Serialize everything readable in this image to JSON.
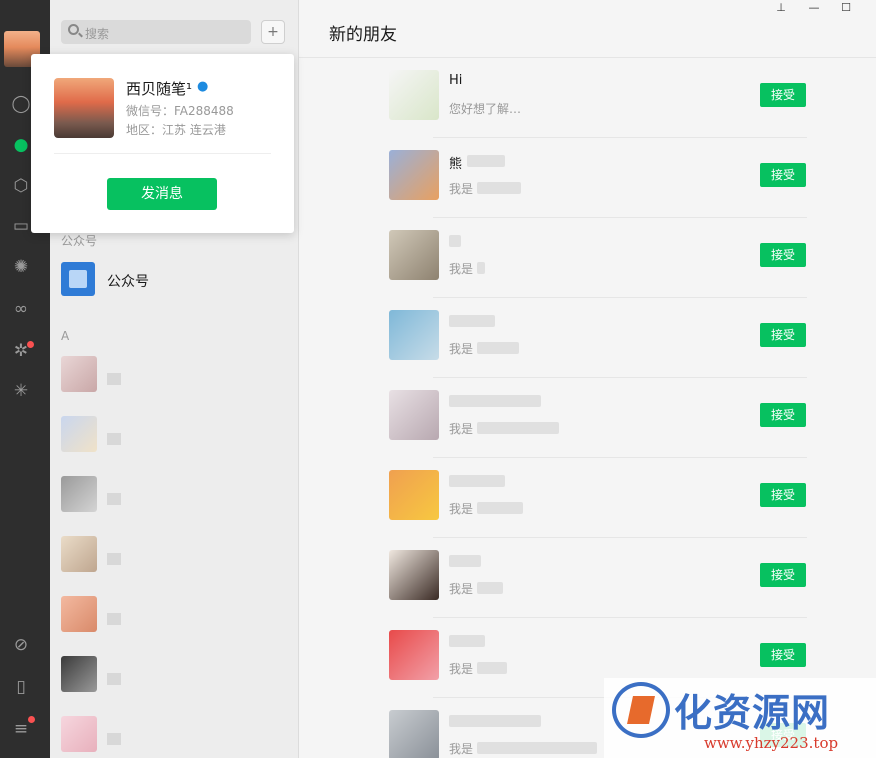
{
  "window": {
    "pin_icon": "pin-icon",
    "minimize_label": "—",
    "maximize_label": "☐"
  },
  "nav": {
    "icons": [
      "chat-icon",
      "contacts-icon",
      "favorites-icon",
      "files-icon",
      "moments-icon",
      "channels-icon",
      "mini-programs-icon",
      "search-icon",
      "miniapp-icon",
      "phone-icon",
      "menu-icon"
    ],
    "accent": "#07c160"
  },
  "search": {
    "placeholder": "搜索",
    "add_label": "+"
  },
  "sections": {
    "public_accounts": "公众号",
    "letter_a": "A"
  },
  "public_account": {
    "label": "公众号"
  },
  "popup": {
    "name": "西贝随笔¹",
    "wechat_id": "微信号：FA288488",
    "region": "地区：江苏 连云港",
    "button_label": "发消息"
  },
  "main": {
    "title": "新的朋友",
    "accept_label": "接受"
  },
  "requests": [
    {
      "name": "Hi",
      "message": "您好想了解…"
    },
    {
      "name": "熊",
      "message": "我是"
    },
    {
      "name": "",
      "message": "我是"
    },
    {
      "name": "",
      "message": "我是"
    },
    {
      "name": "",
      "message": "我是"
    },
    {
      "name": "",
      "message": "我是"
    },
    {
      "name": "",
      "message": "我是"
    },
    {
      "name": "",
      "message": "我是"
    },
    {
      "name": "",
      "message": "我是"
    }
  ],
  "watermark": {
    "text": "化资源网",
    "url": "www.yhzy223.top"
  }
}
